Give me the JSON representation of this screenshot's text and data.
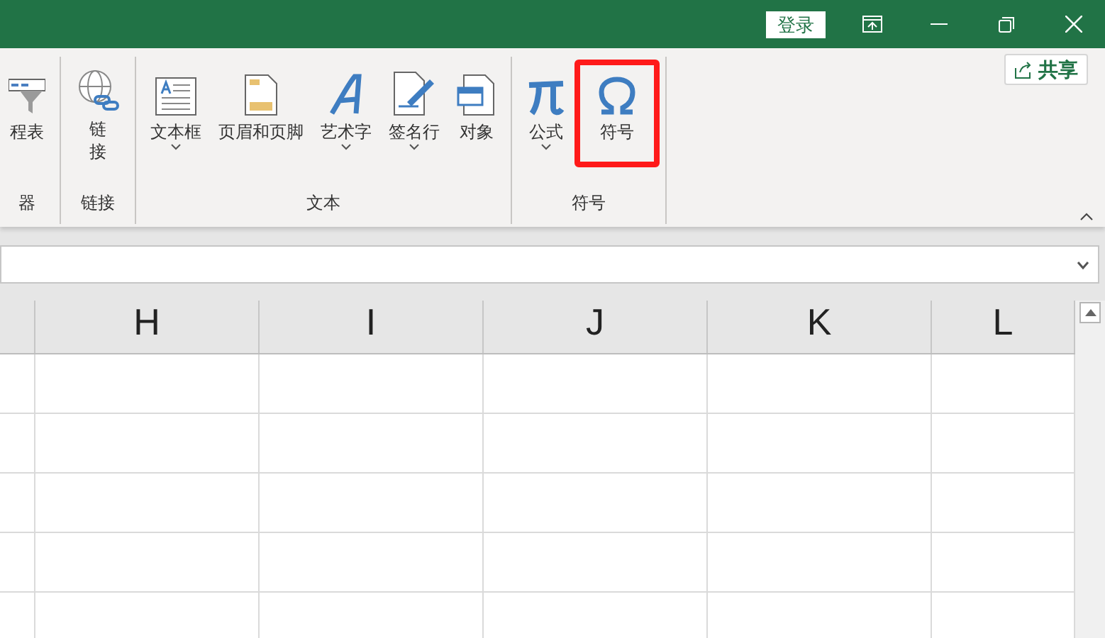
{
  "title_bar": {
    "login_button": "登录"
  },
  "share_button": "共享",
  "ribbon": {
    "groups": [
      {
        "label": "器",
        "buttons": [
          {
            "kind": "timeline",
            "label": "程表",
            "dropdown": false,
            "highlighted": false
          }
        ]
      },
      {
        "label": "链接",
        "buttons": [
          {
            "kind": "link",
            "label": "链接",
            "dropdown": false,
            "highlighted": false
          }
        ]
      },
      {
        "label": "文本",
        "buttons": [
          {
            "kind": "textbox",
            "label": "文本框",
            "dropdown": true,
            "highlighted": false
          },
          {
            "kind": "header",
            "label": "页眉和页脚",
            "dropdown": false,
            "highlighted": false
          },
          {
            "kind": "wordart",
            "label": "艺术字",
            "dropdown": true,
            "highlighted": false
          },
          {
            "kind": "signature",
            "label": "签名行",
            "dropdown": true,
            "highlighted": false
          },
          {
            "kind": "object",
            "label": "对象",
            "dropdown": false,
            "highlighted": false
          }
        ]
      },
      {
        "label": "符号",
        "buttons": [
          {
            "kind": "equation",
            "label": "公式",
            "dropdown": true,
            "highlighted": false
          },
          {
            "kind": "symbol",
            "label": "符号",
            "dropdown": false,
            "highlighted": true
          }
        ]
      }
    ]
  },
  "columns": [
    "H",
    "I",
    "J",
    "K",
    "L"
  ]
}
